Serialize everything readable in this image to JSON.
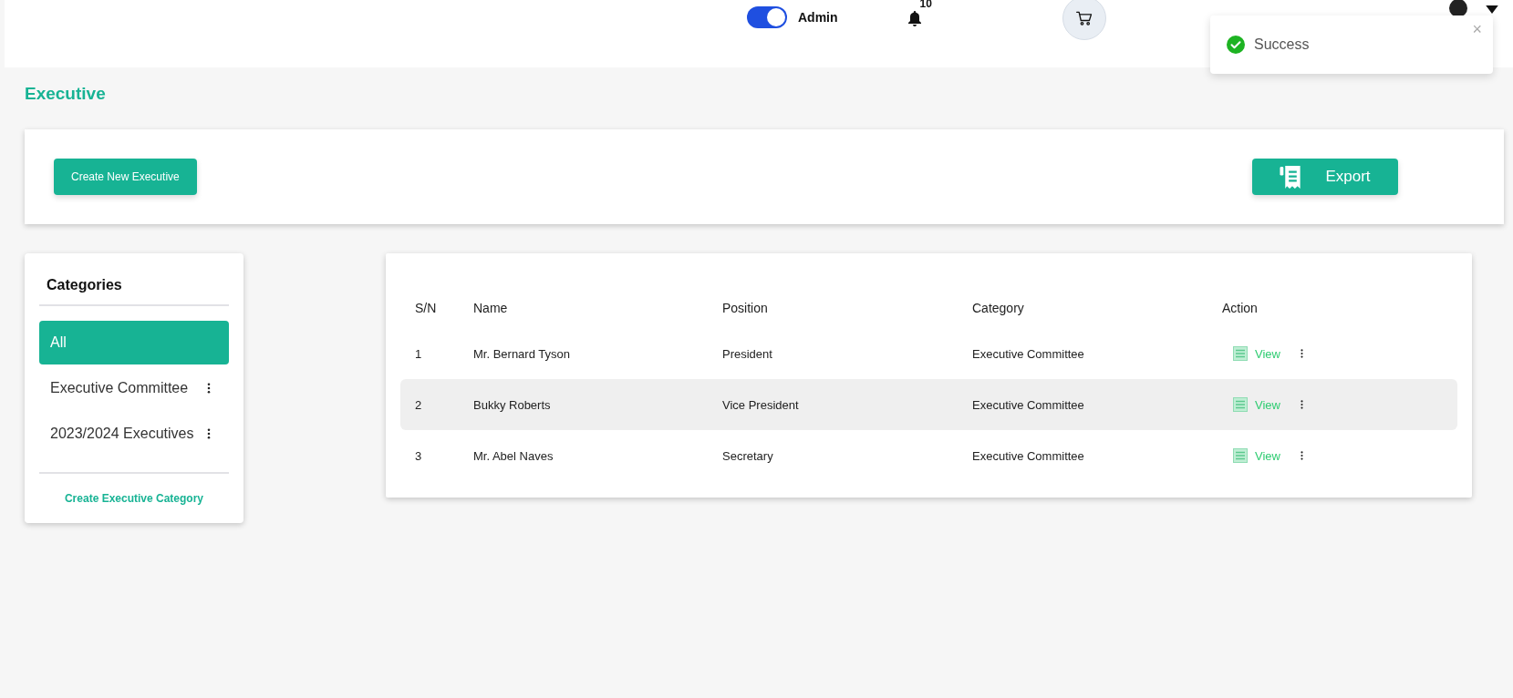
{
  "header": {
    "admin_toggle": {
      "label": "Admin",
      "on": true
    },
    "notifications": {
      "count": "10"
    }
  },
  "toast": {
    "message": "Success",
    "close": "×"
  },
  "page_title": "Executive",
  "toolbar": {
    "create_button": "Create New Executive",
    "export_button": "Export"
  },
  "categories": {
    "title": "Categories",
    "items": [
      {
        "label": "All",
        "selected": true,
        "menu": false
      },
      {
        "label": "Executive Committee",
        "selected": false,
        "menu": true
      },
      {
        "label": "2023/2024 Executives",
        "selected": false,
        "menu": true
      }
    ],
    "create_link": "Create Executive Category"
  },
  "table": {
    "columns": [
      "S/N",
      "Name",
      "Position",
      "Category",
      "Action"
    ],
    "rows": [
      {
        "sn": "1",
        "name": "Mr. Bernard Tyson",
        "position": "President",
        "category": "Executive Committee",
        "action": "View",
        "selected": false
      },
      {
        "sn": "2",
        "name": "Bukky Roberts",
        "position": "Vice President",
        "category": "Executive Committee",
        "action": "View",
        "selected": true
      },
      {
        "sn": "3",
        "name": "Mr. Abel Naves",
        "position": "Secretary",
        "category": "Executive Committee",
        "action": "View",
        "selected": false
      }
    ]
  }
}
